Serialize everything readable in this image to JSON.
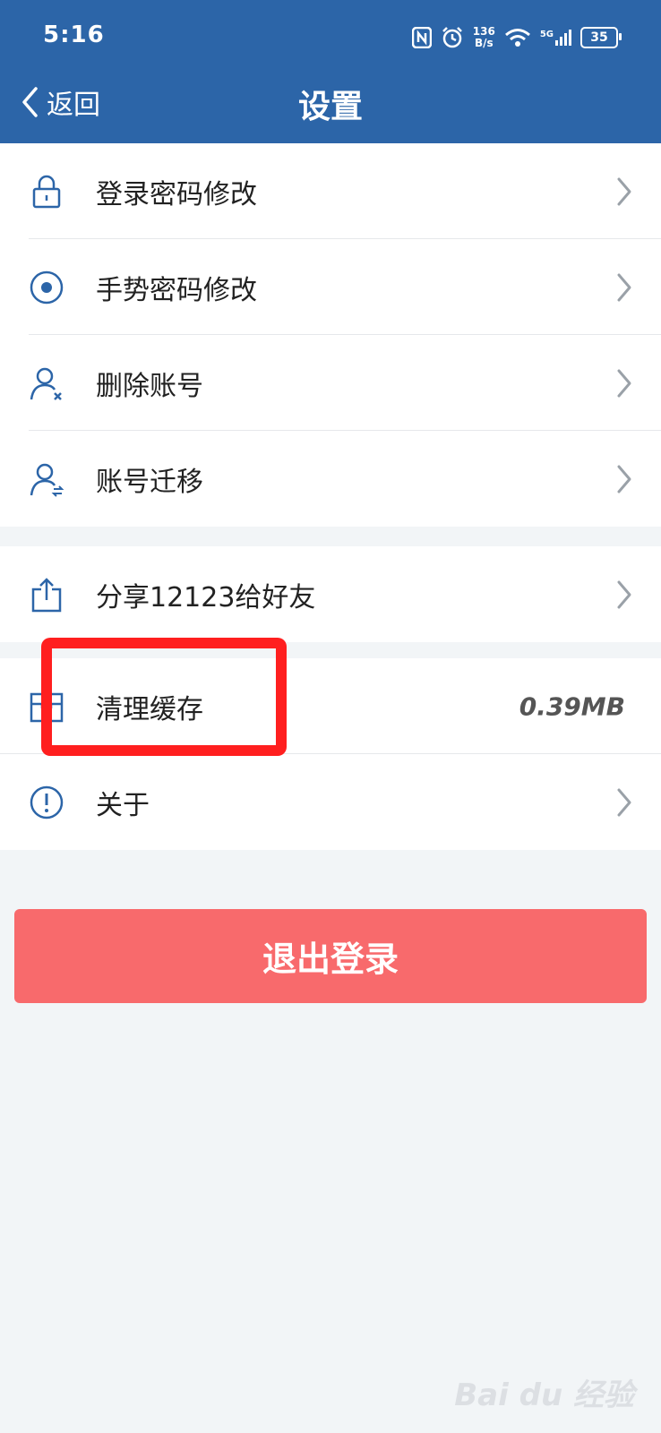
{
  "status": {
    "time": "5:16",
    "net_speed_value": "136",
    "net_speed_unit": "B/s",
    "signal_label": "5G",
    "battery": "35"
  },
  "header": {
    "back_label": "返回",
    "title": "设置"
  },
  "groups": [
    {
      "items": [
        {
          "label": "登录密码修改",
          "icon": "lock-icon"
        },
        {
          "label": "手势密码修改",
          "icon": "target-icon"
        },
        {
          "label": "删除账号",
          "icon": "user-remove-icon"
        },
        {
          "label": "账号迁移",
          "icon": "user-transfer-icon"
        }
      ]
    },
    {
      "items": [
        {
          "label": "分享12123给好友",
          "icon": "share-icon"
        }
      ]
    },
    {
      "items": [
        {
          "label": "清理缓存",
          "icon": "storage-icon",
          "value": "0.39MB"
        },
        {
          "label": "关于",
          "icon": "info-icon"
        }
      ]
    }
  ],
  "logout_label": "退出登录",
  "colors": {
    "header": "#2c65a8",
    "icon": "#2c65a8",
    "logout": "#f86a6c",
    "highlight": "#ff1f1f"
  },
  "watermark": "Bai du 经验"
}
